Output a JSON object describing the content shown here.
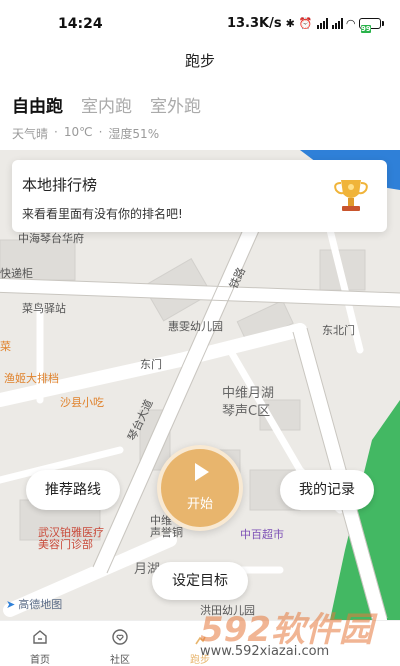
{
  "status_bar": {
    "time": "14:24",
    "speed": "13.3K/s",
    "battery": "99"
  },
  "header": {
    "title": "跑步"
  },
  "tabs": [
    {
      "label": "自由跑",
      "active": true
    },
    {
      "label": "室内跑",
      "active": false
    },
    {
      "label": "室外跑",
      "active": false
    }
  ],
  "weather": {
    "condition": "天气晴",
    "sep1": "·",
    "temperature": "10℃",
    "sep2": "·",
    "humidity": "湿度51%"
  },
  "ranking": {
    "title": "本地排行榜",
    "subtitle": "来看看里面有没有你的排名吧!"
  },
  "map": {
    "labels": {
      "l1": "中海琴台华府",
      "l2": "快递柜",
      "l3": "菜鸟驿站",
      "l4": "惠雯幼儿园",
      "l5": "东门",
      "l6": "东北门",
      "l7": "渔姬大排档",
      "l8": "沙县小吃",
      "l9": "中维月湖",
      "l10": "琴声C区",
      "l11": "武汉铂雅医疗",
      "l12": "美容门诊部",
      "l13": "中维",
      "l14": "声誉铜",
      "l15": "中百超市",
      "l16": "月湖",
      "l17": "铁路",
      "l18": "琴台大道",
      "l19": "菜",
      "l20": "洪田幼儿园"
    },
    "provider": "高德地图"
  },
  "buttons": {
    "route": "推荐路线",
    "start": "开始",
    "record": "我的记录",
    "goal": "设定目标"
  },
  "bottom_nav": [
    {
      "label": "首页",
      "icon": "home-icon"
    },
    {
      "label": "社区",
      "icon": "community-icon"
    },
    {
      "label": "跑步",
      "icon": "run-icon"
    },
    {
      "label": "",
      "icon": ""
    },
    {
      "label": "",
      "icon": ""
    }
  ],
  "watermark": {
    "brand": "592软件园",
    "url": "www.592xiazai.com"
  },
  "colors": {
    "accent": "#e8b56d",
    "map_bg": "#eceae6",
    "water": "#2f80d8",
    "park": "#43b863"
  }
}
